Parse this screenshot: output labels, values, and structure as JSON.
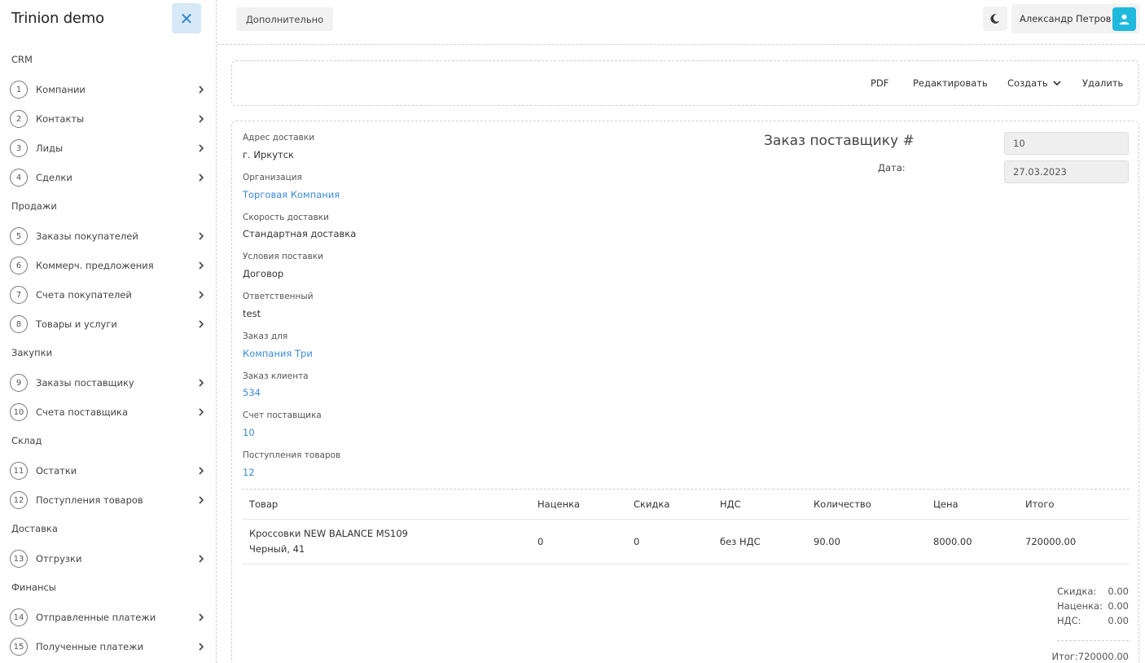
{
  "app": {
    "title": "Trinion demo"
  },
  "sidebar": {
    "sections": [
      {
        "label": "CRM",
        "items": [
          {
            "num": "1",
            "label": "Компании"
          },
          {
            "num": "2",
            "label": "Контакты"
          },
          {
            "num": "3",
            "label": "Лиды"
          },
          {
            "num": "4",
            "label": "Сделки"
          }
        ]
      },
      {
        "label": "Продажи",
        "items": [
          {
            "num": "5",
            "label": "Заказы покупателей"
          },
          {
            "num": "6",
            "label": "Коммерч. предложения"
          },
          {
            "num": "7",
            "label": "Счета покупателей"
          },
          {
            "num": "8",
            "label": "Товары и услуги"
          }
        ]
      },
      {
        "label": "Закупки",
        "items": [
          {
            "num": "9",
            "label": "Заказы поставщику"
          },
          {
            "num": "10",
            "label": "Счета поставщика"
          }
        ]
      },
      {
        "label": "Склад",
        "items": [
          {
            "num": "11",
            "label": "Остатки"
          },
          {
            "num": "12",
            "label": "Поступления товаров"
          }
        ]
      },
      {
        "label": "Доставка",
        "items": [
          {
            "num": "13",
            "label": "Отгрузки"
          }
        ]
      },
      {
        "label": "Финансы",
        "items": [
          {
            "num": "14",
            "label": "Отправленные платежи"
          },
          {
            "num": "15",
            "label": "Полученные платежи"
          }
        ]
      }
    ]
  },
  "topbar": {
    "more_label": "Дополнительно",
    "user_name": "Александр Петров"
  },
  "actions": {
    "pdf": "PDF",
    "edit": "Редактировать",
    "create": "Создать",
    "delete": "Удалить"
  },
  "order": {
    "title": "Заказ поставщику #",
    "number": "10",
    "date_label": "Дата:",
    "date": "27.03.2023",
    "fields": [
      {
        "label": "Адрес доставки",
        "value": "г. Иркутск",
        "link": false
      },
      {
        "label": "Организация",
        "value": "Торговая Компания",
        "link": true
      },
      {
        "label": "Скорость доставки",
        "value": "Стандартная доставка",
        "link": false
      },
      {
        "label": "Условия поставки",
        "value": "Договор",
        "link": false
      },
      {
        "label": "Ответственный",
        "value": "test",
        "link": false
      },
      {
        "label": "Заказ для",
        "value": "Компания Три",
        "link": true
      },
      {
        "label": "Заказ клиента",
        "value": "534",
        "link": true
      },
      {
        "label": "Счет поставщика",
        "value": "10",
        "link": true
      },
      {
        "label": "Поступления товаров",
        "value": "12",
        "link": true
      }
    ]
  },
  "table": {
    "headers": [
      "Товар",
      "Наценка",
      "Скидка",
      "НДС",
      "Количество",
      "Цена",
      "Итого"
    ],
    "rows": [
      {
        "product_line1": "Кроссовки NEW BALANCE MS109",
        "product_line2": "Черный, 41",
        "markup": "0",
        "discount": "0",
        "vat": "без НДС",
        "qty": "90.00",
        "price": "8000.00",
        "total": "720000.00"
      }
    ]
  },
  "totals": {
    "discount_label": "Скидка:",
    "discount": "0.00",
    "markup_label": "Наценка:",
    "markup": "0.00",
    "vat_label": "НДС:",
    "vat": "0.00",
    "grand": "Итог:720000.00"
  },
  "colors": {
    "accent": "#3b8ad9",
    "avatar_bg": "#1fb9dd",
    "close_bg": "#d7e8f7"
  },
  "icons": {
    "close": "close-icon",
    "theme": "moon-icon",
    "user": "user-icon",
    "chevron": "chevron-right-icon"
  }
}
